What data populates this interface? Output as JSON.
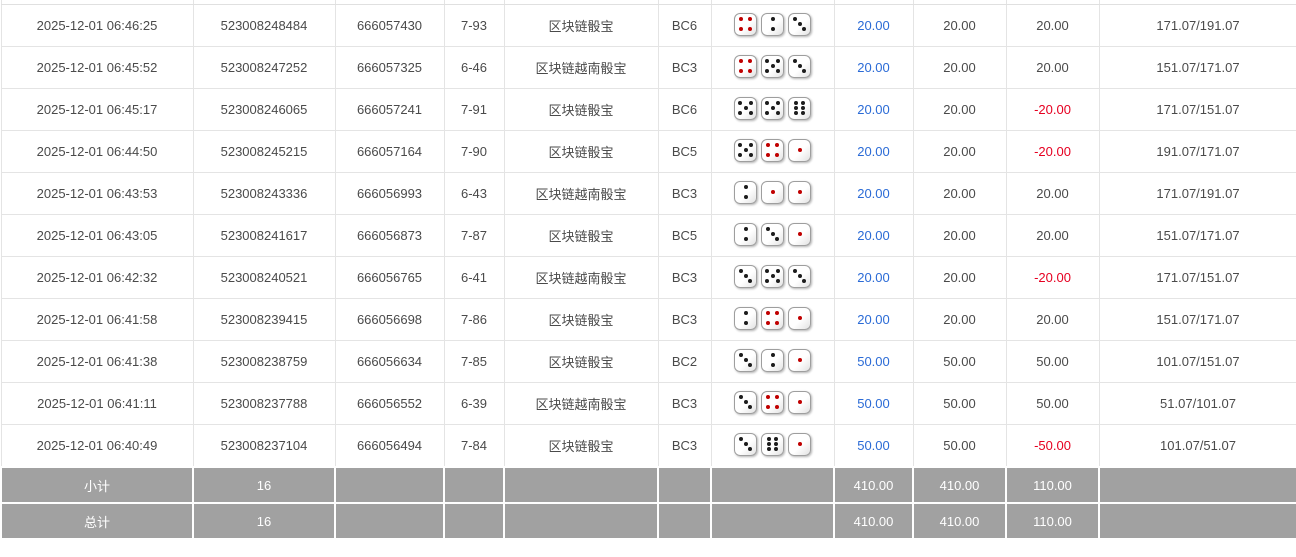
{
  "colors": {
    "link_blue": "#2b6bd6",
    "negative_red": "#e60021",
    "summary_bg": "#a1a1a1",
    "dice_red": "#c00000",
    "dice_black": "#1c1c1c"
  },
  "table": {
    "rows": [
      {
        "time": "2025-12-01 06:46:25",
        "bet_id": "523008248484",
        "round_id": "666057430",
        "period": "7-93",
        "game": "区块链骰宝",
        "table_code": "BC6",
        "dice": [
          4,
          2,
          3
        ],
        "bet": "20.00",
        "valid": "20.00",
        "win_loss": "20.00",
        "balance": "171.07/191.07"
      },
      {
        "time": "2025-12-01 06:45:52",
        "bet_id": "523008247252",
        "round_id": "666057325",
        "period": "6-46",
        "game": "区块链越南骰宝",
        "table_code": "BC3",
        "dice": [
          4,
          5,
          3
        ],
        "bet": "20.00",
        "valid": "20.00",
        "win_loss": "20.00",
        "balance": "151.07/171.07"
      },
      {
        "time": "2025-12-01 06:45:17",
        "bet_id": "523008246065",
        "round_id": "666057241",
        "period": "7-91",
        "game": "区块链骰宝",
        "table_code": "BC6",
        "dice": [
          5,
          5,
          6
        ],
        "bet": "20.00",
        "valid": "20.00",
        "win_loss": "-20.00",
        "balance": "171.07/151.07"
      },
      {
        "time": "2025-12-01 06:44:50",
        "bet_id": "523008245215",
        "round_id": "666057164",
        "period": "7-90",
        "game": "区块链骰宝",
        "table_code": "BC5",
        "dice": [
          5,
          4,
          1
        ],
        "bet": "20.00",
        "valid": "20.00",
        "win_loss": "-20.00",
        "balance": "191.07/171.07"
      },
      {
        "time": "2025-12-01 06:43:53",
        "bet_id": "523008243336",
        "round_id": "666056993",
        "period": "6-43",
        "game": "区块链越南骰宝",
        "table_code": "BC3",
        "dice": [
          2,
          1,
          1
        ],
        "bet": "20.00",
        "valid": "20.00",
        "win_loss": "20.00",
        "balance": "171.07/191.07"
      },
      {
        "time": "2025-12-01 06:43:05",
        "bet_id": "523008241617",
        "round_id": "666056873",
        "period": "7-87",
        "game": "区块链骰宝",
        "table_code": "BC5",
        "dice": [
          2,
          3,
          1
        ],
        "bet": "20.00",
        "valid": "20.00",
        "win_loss": "20.00",
        "balance": "151.07/171.07"
      },
      {
        "time": "2025-12-01 06:42:32",
        "bet_id": "523008240521",
        "round_id": "666056765",
        "period": "6-41",
        "game": "区块链越南骰宝",
        "table_code": "BC3",
        "dice": [
          3,
          5,
          3
        ],
        "bet": "20.00",
        "valid": "20.00",
        "win_loss": "-20.00",
        "balance": "171.07/151.07"
      },
      {
        "time": "2025-12-01 06:41:58",
        "bet_id": "523008239415",
        "round_id": "666056698",
        "period": "7-86",
        "game": "区块链骰宝",
        "table_code": "BC3",
        "dice": [
          2,
          4,
          1
        ],
        "bet": "20.00",
        "valid": "20.00",
        "win_loss": "20.00",
        "balance": "151.07/171.07"
      },
      {
        "time": "2025-12-01 06:41:38",
        "bet_id": "523008238759",
        "round_id": "666056634",
        "period": "7-85",
        "game": "区块链骰宝",
        "table_code": "BC2",
        "dice": [
          3,
          2,
          1
        ],
        "bet": "50.00",
        "valid": "50.00",
        "win_loss": "50.00",
        "balance": "101.07/151.07"
      },
      {
        "time": "2025-12-01 06:41:11",
        "bet_id": "523008237788",
        "round_id": "666056552",
        "period": "6-39",
        "game": "区块链越南骰宝",
        "table_code": "BC3",
        "dice": [
          3,
          4,
          1
        ],
        "bet": "50.00",
        "valid": "50.00",
        "win_loss": "50.00",
        "balance": "51.07/101.07"
      },
      {
        "time": "2025-12-01 06:40:49",
        "bet_id": "523008237104",
        "round_id": "666056494",
        "period": "7-84",
        "game": "区块链骰宝",
        "table_code": "BC3",
        "dice": [
          3,
          6,
          1
        ],
        "bet": "50.00",
        "valid": "50.00",
        "win_loss": "-50.00",
        "balance": "101.07/51.07"
      }
    ],
    "summary_rows": [
      {
        "label": "小计",
        "count": "16",
        "bet": "410.00",
        "valid": "410.00",
        "win_loss": "110.00"
      },
      {
        "label": "总计",
        "count": "16",
        "bet": "410.00",
        "valid": "410.00",
        "win_loss": "110.00"
      }
    ]
  }
}
